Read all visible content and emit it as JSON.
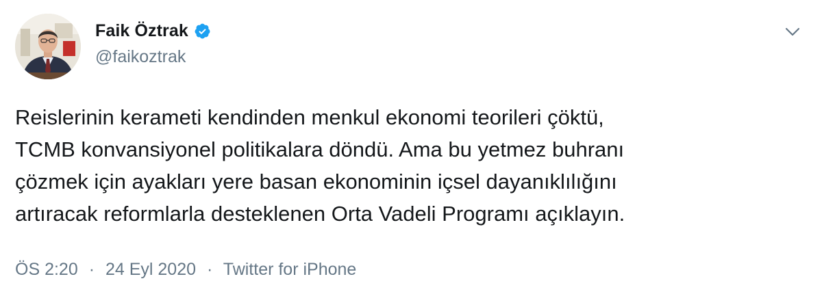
{
  "author": {
    "display_name": "Faik Öztrak",
    "handle": "@faikoztrak",
    "verified": true
  },
  "tweet": {
    "text": "Reislerinin kerameti kendinden menkul ekonomi teorileri çöktü,\nTCMB konvansiyonel politikalara döndü. Ama bu yetmez buhranı\nçözmek için ayakları yere basan ekonominin içsel dayanıklılığını\nartıracak reformlarla desteklenen Orta Vadeli Programı açıklayın.",
    "time": "ÖS 2:20",
    "separator": "·",
    "date": "24 Eyl 2020",
    "source": "Twitter for iPhone"
  },
  "icons": {
    "verified": "verified-badge-icon",
    "menu": "chevron-down-icon"
  },
  "colors": {
    "text_primary": "#14171a",
    "text_secondary": "#657786",
    "verified_blue": "#1da1f2"
  }
}
